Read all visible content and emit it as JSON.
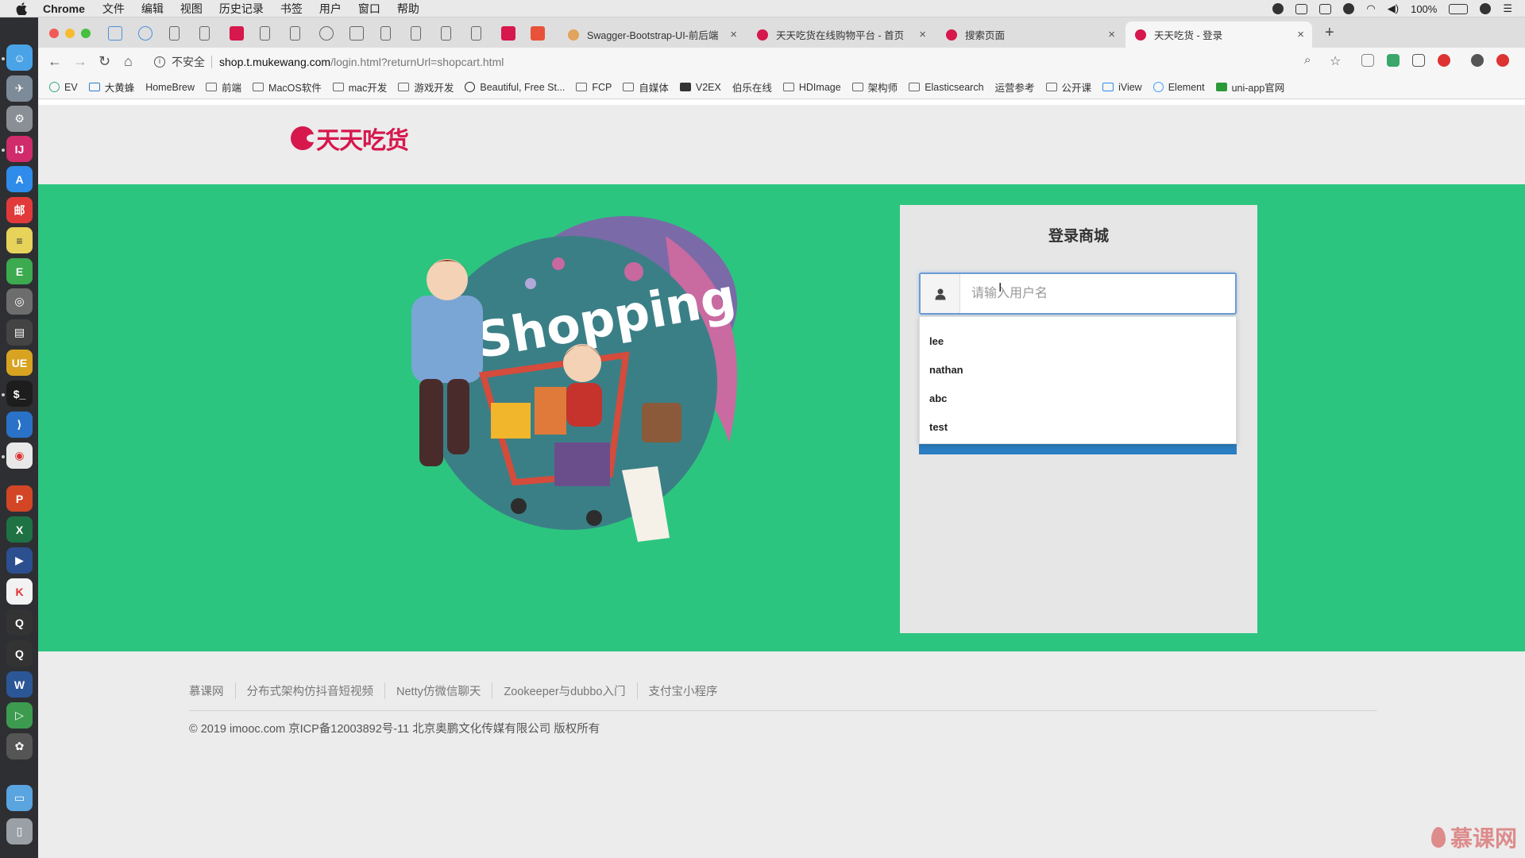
{
  "menubar": {
    "app": "Chrome",
    "items": [
      "文件",
      "编辑",
      "视图",
      "历史记录",
      "书签",
      "用户",
      "窗口",
      "帮助"
    ],
    "battery": "100%"
  },
  "tabs": [
    {
      "title": "Swagger-Bootstrap-UI-前后端",
      "icon": "swagger-icon"
    },
    {
      "title": "天天吃货在线购物平台 - 首页",
      "icon": "foodie-logo-icon"
    },
    {
      "title": "搜索页面",
      "icon": "foodie-logo-icon"
    },
    {
      "title": "天天吃货 - 登录",
      "icon": "foodie-logo-icon",
      "active": true
    }
  ],
  "address": {
    "security": "不安全",
    "host": "shop.t.mukewang.com",
    "path": "/login.html?returnUrl=shopcart.html"
  },
  "bookmarks": [
    {
      "label": "EV",
      "icon": "ev-icon"
    },
    {
      "label": "大黄蜂",
      "icon": "shield-icon"
    },
    {
      "label": "HomeBrew",
      "icon": "beer-icon"
    },
    {
      "label": "前端",
      "icon": "folder-icon"
    },
    {
      "label": "MacOS软件",
      "icon": "folder-icon"
    },
    {
      "label": "mac开发",
      "icon": "folder-icon"
    },
    {
      "label": "游戏开发",
      "icon": "folder-icon"
    },
    {
      "label": "Beautiful, Free St...",
      "icon": "circle-icon"
    },
    {
      "label": "FCP",
      "icon": "folder-icon"
    },
    {
      "label": "自媒体",
      "icon": "folder-icon"
    },
    {
      "label": "V2EX",
      "icon": "v2ex-icon"
    },
    {
      "label": "伯乐在线",
      "icon": "page-icon"
    },
    {
      "label": "HDImage",
      "icon": "folder-icon"
    },
    {
      "label": "架构师",
      "icon": "folder-icon"
    },
    {
      "label": "Elasticsearch",
      "icon": "folder-icon"
    },
    {
      "label": "运营参考",
      "icon": "page-icon"
    },
    {
      "label": "公开课",
      "icon": "folder-icon"
    },
    {
      "label": "iView",
      "icon": "iview-icon"
    },
    {
      "label": "Element",
      "icon": "element-icon"
    },
    {
      "label": "uni-app官网",
      "icon": "uniapp-icon"
    }
  ],
  "site": {
    "logo_text": "天天吃货"
  },
  "illustration": {
    "text": "Shopping"
  },
  "login": {
    "title": "登录商城",
    "username_placeholder": "请输入用户名",
    "autocomplete": [
      "lee",
      "nathan",
      "abc",
      "test"
    ]
  },
  "footer": {
    "links": [
      "慕课网",
      "分布式架构仿抖音短视频",
      "Netty仿微信聊天",
      "Zookeeper与dubbo入门",
      "支付宝小程序"
    ],
    "copyright": "© 2019 imooc.com 京ICP备12003892号-11 北京奥鹏文化传媒有限公司 版权所有"
  },
  "watermark": "慕课网",
  "colors": {
    "hero_bg": "#2cc57f",
    "brand": "#d6184d",
    "button": "#2b7fc2"
  }
}
